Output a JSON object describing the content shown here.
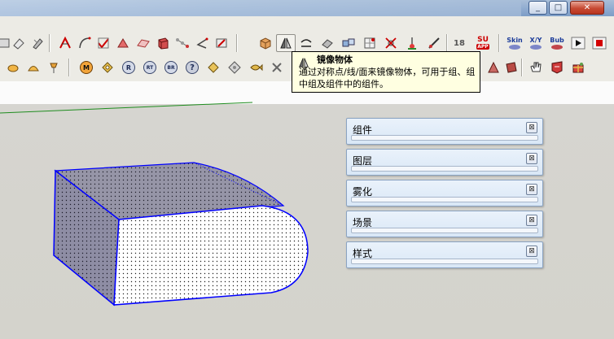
{
  "window": {
    "minimize_glyph": "_",
    "maximize_glyph": "□",
    "close_glyph": "✕"
  },
  "toolbar_row1": {
    "text_buttons": {
      "eighteen": "18",
      "su_app": "SU",
      "su_app_sub": "APP",
      "skin": "Skin",
      "xy": "X/Y",
      "bub": "Bub"
    }
  },
  "toolbar_row2": {
    "circle_labels": [
      "M",
      "R",
      "RT",
      "BR",
      "?"
    ]
  },
  "tooltip": {
    "title": "镜像物体",
    "description": "通过对称点/线/面来镜像物体，可用于组、组中组及组件中的组件。"
  },
  "trays": [
    {
      "label": "组件"
    },
    {
      "label": "图层"
    },
    {
      "label": "雾化"
    },
    {
      "label": "场景"
    },
    {
      "label": "样式"
    }
  ],
  "tray_close_glyph": "⊠",
  "colors": {
    "edge_blue": "#0000ff",
    "axis_green": "#1e8c1e",
    "tooltip_bg": "#ffffe1"
  }
}
